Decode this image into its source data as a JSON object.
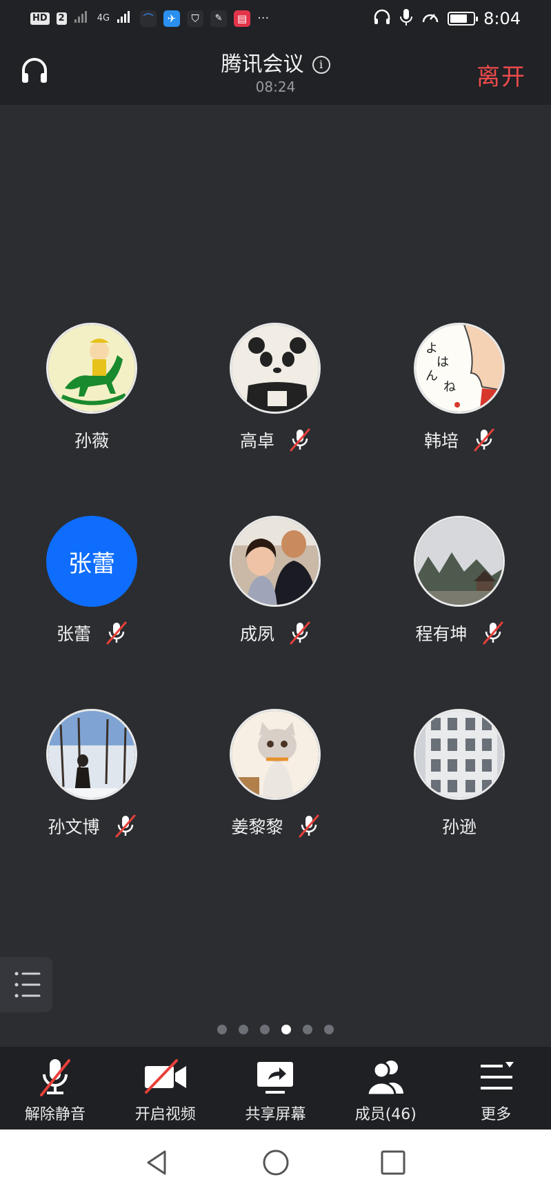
{
  "status_bar": {
    "hd_label": "HD",
    "sim_label": "2",
    "signal_label": "4G",
    "time": "8:04",
    "battery_percent": 75
  },
  "header": {
    "title": "腾讯会议",
    "elapsed": "08:24",
    "leave_label": "离开"
  },
  "members": [
    {
      "name": "孙薇",
      "muted": false,
      "avatar": "cartoon-horse"
    },
    {
      "name": "高卓",
      "muted": true,
      "avatar": "panda"
    },
    {
      "name": "韩培",
      "muted": true,
      "avatar": "japanese-text"
    },
    {
      "name": "张蕾",
      "muted": true,
      "avatar": "text",
      "avatar_text": "张蕾"
    },
    {
      "name": "成夙",
      "muted": true,
      "avatar": "family-photo"
    },
    {
      "name": "程有坤",
      "muted": true,
      "avatar": "landscape"
    },
    {
      "name": "孙文博",
      "muted": true,
      "avatar": "snow-trees"
    },
    {
      "name": "姜黎黎",
      "muted": true,
      "avatar": "kitten"
    },
    {
      "name": "孙逊",
      "muted": false,
      "avatar": "building"
    }
  ],
  "pagination": {
    "total": 6,
    "current": 4
  },
  "toolbar": {
    "unmute_label": "解除静音",
    "video_label": "开启视频",
    "share_label": "共享屏幕",
    "members_label": "成员(46)",
    "more_label": "更多"
  },
  "colors": {
    "background": "#2b2d31",
    "bar": "#202226",
    "leave": "#ee4b4b",
    "avatar_blue": "#0e6dfd",
    "mute_slash": "#e8403a"
  }
}
